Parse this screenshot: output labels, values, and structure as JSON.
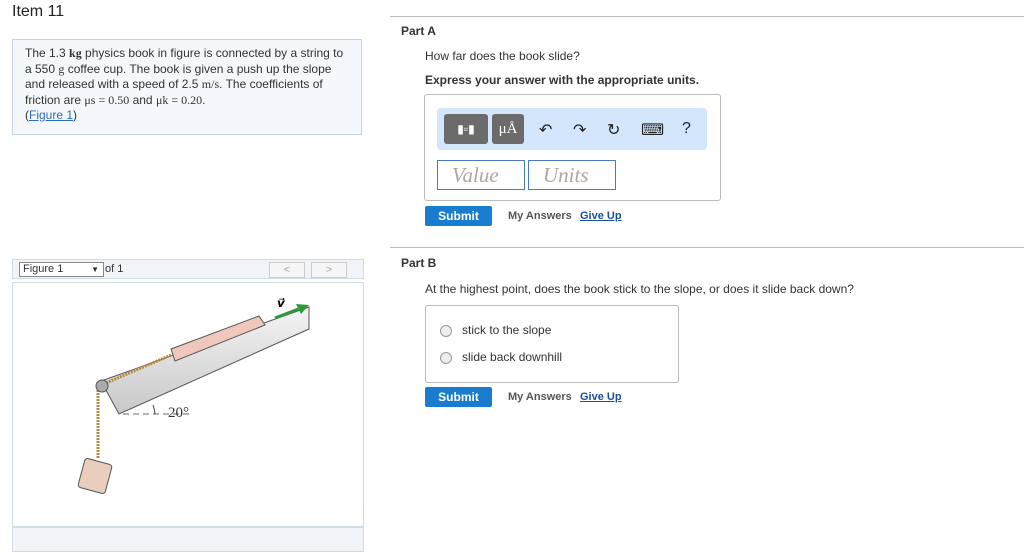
{
  "item_title": "Item 11",
  "problem": {
    "segments": [
      "The 1.3 ",
      "kg",
      " physics book in figure is connected by a string to a 550 ",
      "g",
      " coffee cup. The book is given a push up the slope and released with a speed of 2.5 ",
      "m/s",
      ". The coefficients of friction are ",
      "μs = 0.50",
      " and ",
      "μk = 0.20",
      "."
    ],
    "figure_link": "Figure 1"
  },
  "figure": {
    "selector": "Figure 1",
    "of_label": "of 1",
    "prev": "<",
    "next": ">",
    "angle_label": "20°",
    "vector_label": "v⃗"
  },
  "part_a": {
    "title": "Part A",
    "question": "How far does the book slide?",
    "instruction": "Express your answer with the appropriate units.",
    "toolbar": {
      "templates": "templates",
      "units": "μÅ",
      "undo": "↶",
      "redo": "↷",
      "reset": "↻",
      "keyboard": "⌨",
      "help": "?"
    },
    "value_placeholder": "Value",
    "units_placeholder": "Units",
    "submit": "Submit",
    "my_answers": "My Answers",
    "give_up": "Give Up"
  },
  "part_b": {
    "title": "Part B",
    "question": "At the highest point, does the book stick to the slope, or does it slide back down?",
    "options": [
      "stick to the slope",
      "slide back downhill"
    ],
    "submit": "Submit",
    "my_answers": "My Answers",
    "give_up": "Give Up"
  }
}
